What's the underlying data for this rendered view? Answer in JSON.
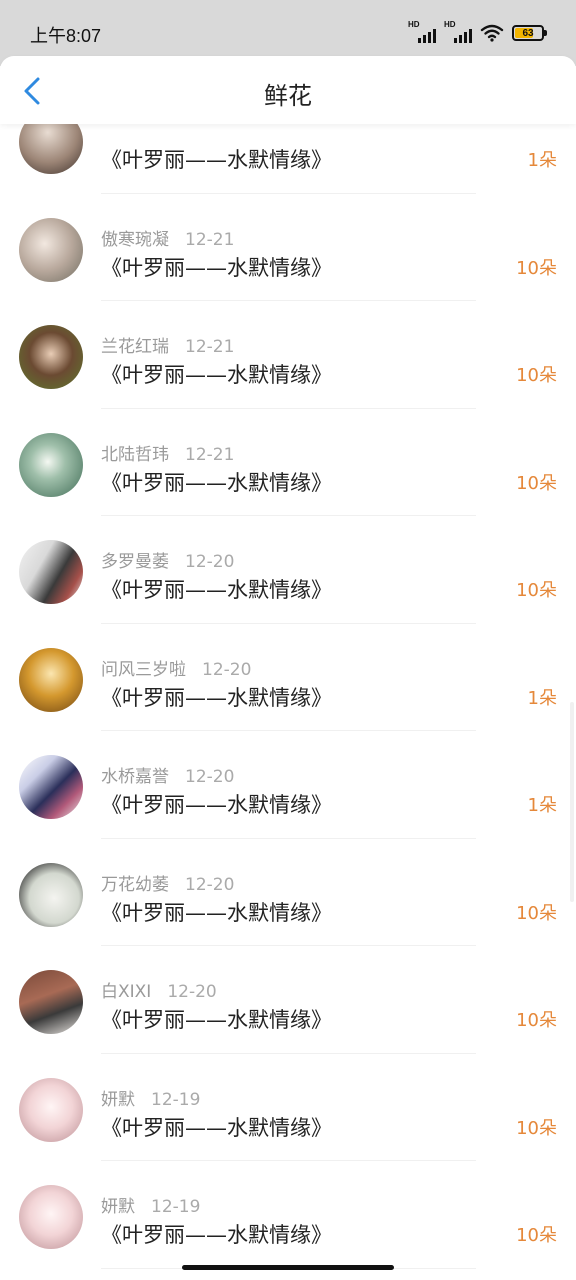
{
  "status_bar": {
    "time": "上午8:07",
    "battery_level": "63",
    "network_badge": "HD"
  },
  "header": {
    "title": "鲜花"
  },
  "colors": {
    "accent": "#2f8ae0",
    "count": "#e5883a",
    "battery": "#f3b500"
  },
  "items": [
    {
      "name": "",
      "date": "",
      "title": "《叶罗丽——水默情缘》",
      "count": "1朵"
    },
    {
      "name": "傲寒琬凝",
      "date": "12-21",
      "title": "《叶罗丽——水默情缘》",
      "count": "10朵"
    },
    {
      "name": "兰花红瑞",
      "date": "12-21",
      "title": "《叶罗丽——水默情缘》",
      "count": "10朵"
    },
    {
      "name": "北陆哲玮",
      "date": "12-21",
      "title": "《叶罗丽——水默情缘》",
      "count": "10朵"
    },
    {
      "name": "多罗曼萎",
      "date": "12-20",
      "title": "《叶罗丽——水默情缘》",
      "count": "10朵"
    },
    {
      "name": "问风三岁啦",
      "date": "12-20",
      "title": "《叶罗丽——水默情缘》",
      "count": "1朵"
    },
    {
      "name": "水桥嘉誉",
      "date": "12-20",
      "title": "《叶罗丽——水默情缘》",
      "count": "1朵"
    },
    {
      "name": "万花幼萎",
      "date": "12-20",
      "title": "《叶罗丽——水默情缘》",
      "count": "10朵"
    },
    {
      "name": "白XIXI",
      "date": "12-20",
      "title": "《叶罗丽——水默情缘》",
      "count": "10朵"
    },
    {
      "name": "妍默",
      "date": "12-19",
      "title": "《叶罗丽——水默情缘》",
      "count": "10朵"
    },
    {
      "name": "妍默",
      "date": "12-19",
      "title": "《叶罗丽——水默情缘》",
      "count": "10朵"
    }
  ]
}
